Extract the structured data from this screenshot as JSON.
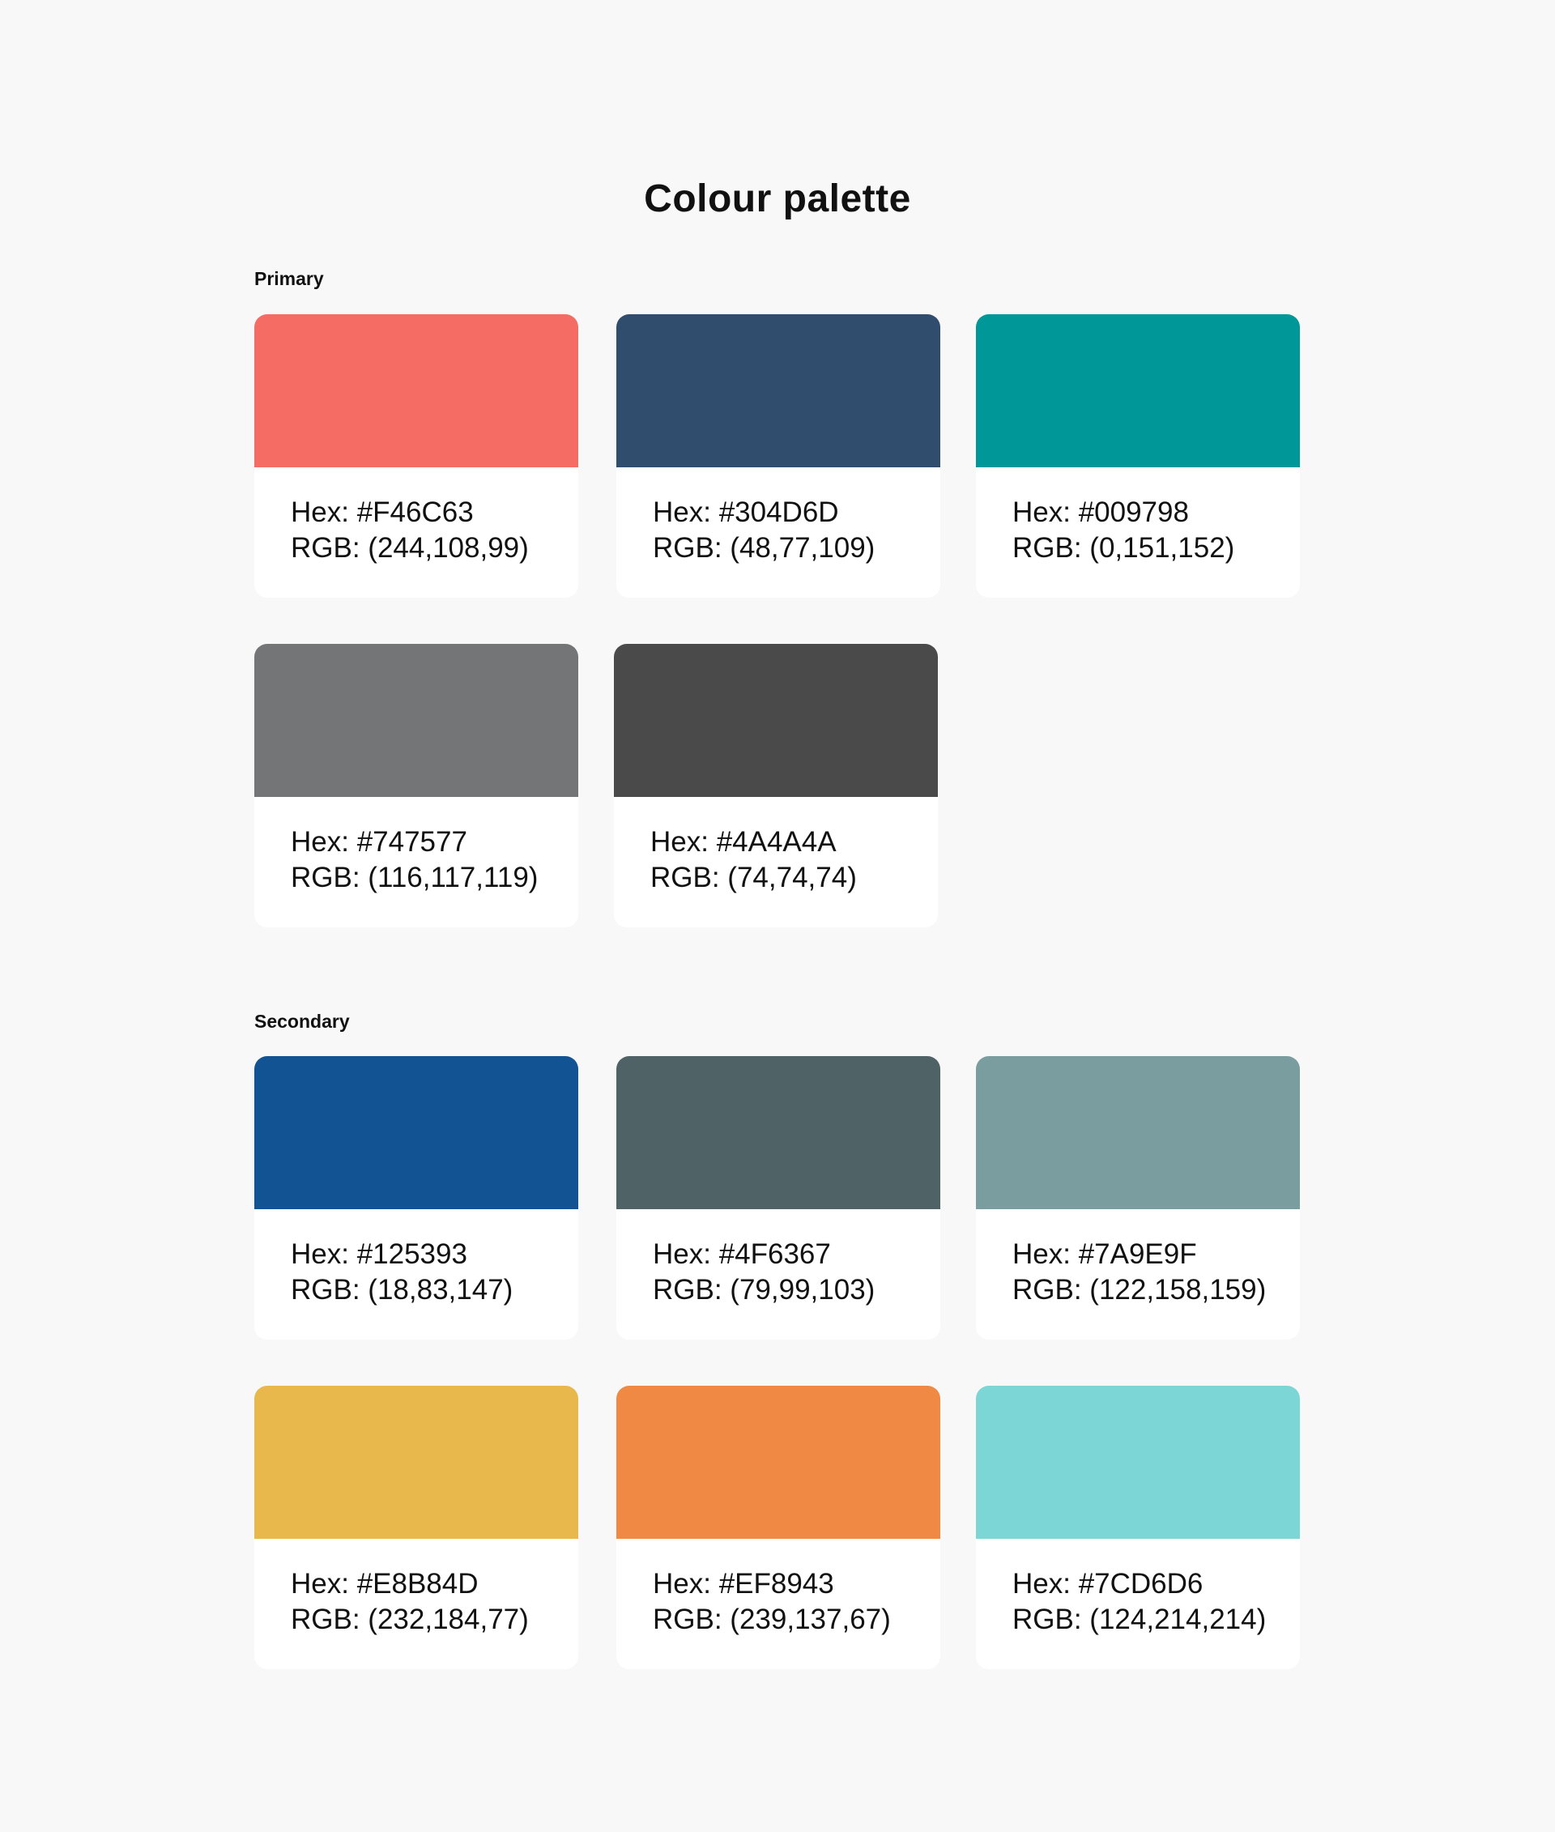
{
  "title": "Colour palette",
  "sections": [
    {
      "label": "Primary",
      "colors": [
        {
          "hex": "Hex: #F46C63",
          "rgb": "RGB: (244,108,99)",
          "swatch": "#F46C63"
        },
        {
          "hex": "Hex: #304D6D",
          "rgb": "RGB: (48,77,109)",
          "swatch": "#304D6D"
        },
        {
          "hex": "Hex: #009798",
          "rgb": "RGB: (0,151,152)",
          "swatch": "#009798"
        },
        {
          "hex": "Hex: #747577",
          "rgb": "RGB: (116,117,119)",
          "swatch": "#747577"
        },
        {
          "hex": "Hex: #4A4A4A",
          "rgb": "RGB: (74,74,74)",
          "swatch": "#4A4A4A"
        }
      ]
    },
    {
      "label": "Secondary",
      "colors": [
        {
          "hex": "Hex: #125393",
          "rgb": "RGB: (18,83,147)",
          "swatch": "#125393"
        },
        {
          "hex": "Hex: #4F6367",
          "rgb": "RGB: (79,99,103)",
          "swatch": "#4F6367"
        },
        {
          "hex": "Hex: #7A9E9F",
          "rgb": "RGB: (122,158,159)",
          "swatch": "#7A9E9F"
        },
        {
          "hex": "Hex: #E8B84D",
          "rgb": "RGB: (232,184,77)",
          "swatch": "#E8B84D"
        },
        {
          "hex": "Hex: #EF8943",
          "rgb": "RGB: (239,137,67)",
          "swatch": "#EF8943"
        },
        {
          "hex": "Hex: #7CD6D6",
          "rgb": "RGB: (124,214,214)",
          "swatch": "#7CD6D6"
        }
      ]
    }
  ]
}
